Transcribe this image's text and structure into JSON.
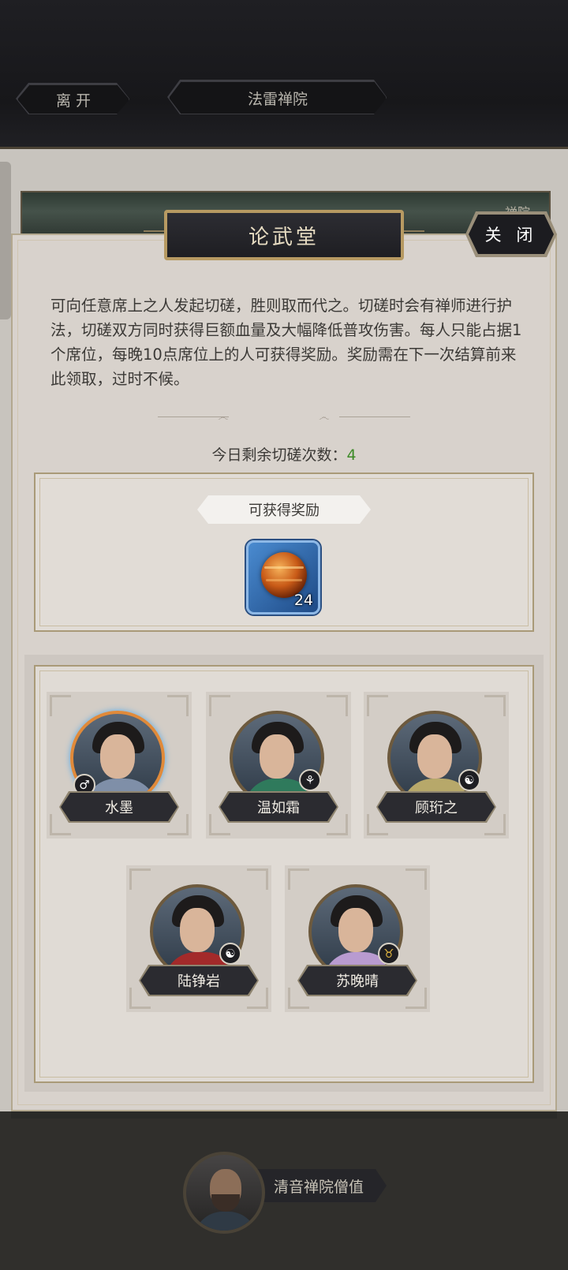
{
  "topbar": {
    "leave_label": "离 开",
    "location_label": "法雷禅院"
  },
  "scene": {
    "strip_label": "禅院"
  },
  "panel": {
    "title": "论武堂",
    "close_label": "关 闭",
    "description": "可向任意席上之人发起切磋，胜则取而代之。切磋时会有禅师进行护法，切磋双方同时获得巨额血量及大幅降低普攻伤害。每人只能占据1个席位，每晚10点席位上的人可获得奖励。奖励需在下一次结算前来此领取，过时不候。",
    "remaining_label": "今日剩余切磋次数：",
    "remaining_count": "4",
    "remaining_color": "#3c8a26"
  },
  "reward": {
    "label": "可获得奖励",
    "item_icon": "fire-orb-icon",
    "item_count": "24"
  },
  "seats": [
    {
      "name": "水墨",
      "badge": "♂",
      "badge_icon": "male-icon",
      "robe": "#7f8fa8"
    },
    {
      "name": "温如霜",
      "badge": "⚘",
      "badge_icon": "leaf-icon",
      "robe": "#2f7a5c"
    },
    {
      "name": "顾珩之",
      "badge": "☯",
      "badge_icon": "yinyang-icon",
      "robe": "#b7a86a"
    },
    {
      "name": "陆铮岩",
      "badge": "☯",
      "badge_icon": "yinyang-icon",
      "robe": "#a32a2a"
    },
    {
      "name": "苏晚晴",
      "badge": "♉",
      "badge_icon": "bull-icon",
      "robe": "#b89bd0"
    }
  ],
  "npc": {
    "name": "清音禅院僧值"
  }
}
